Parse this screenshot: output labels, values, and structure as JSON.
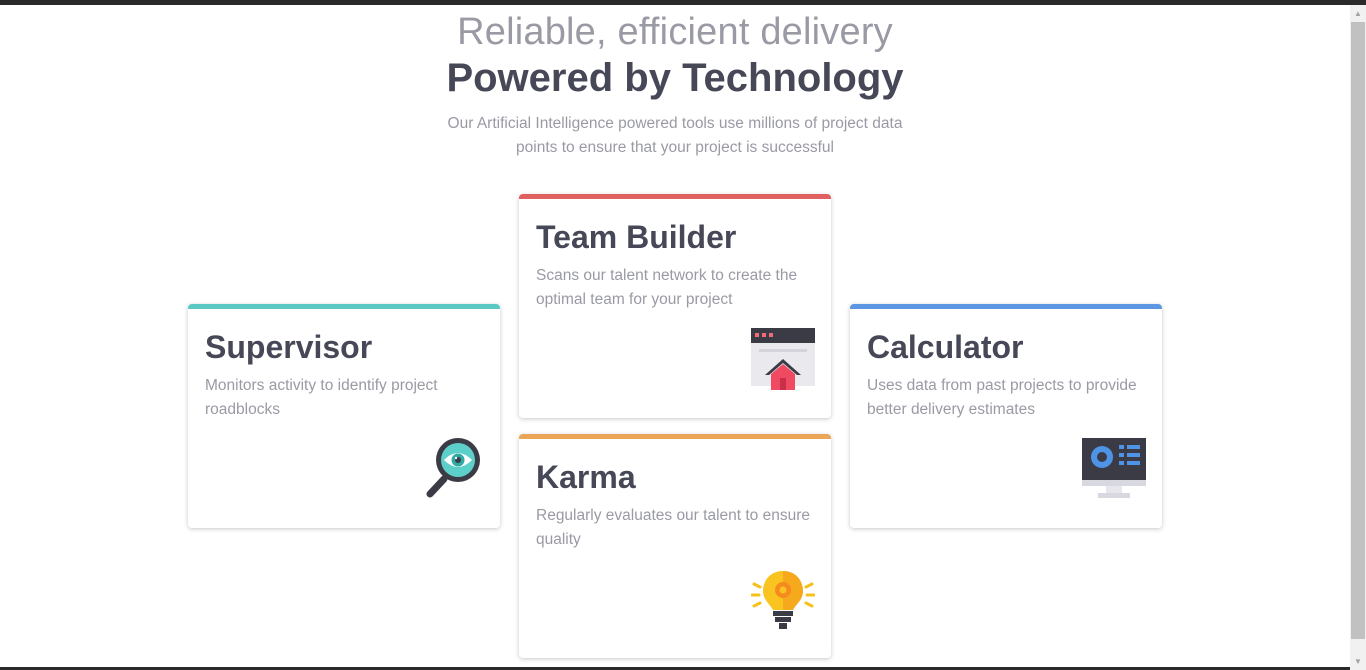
{
  "header": {
    "subheading": "Reliable, efficient delivery",
    "heading": "Powered by Technology",
    "description": "Our Artificial Intelligence powered tools use millions of project data points to ensure that your project is successful"
  },
  "cards": {
    "supervisor": {
      "title": "Supervisor",
      "description": "Monitors activity to identify project roadblocks",
      "icon": "magnifier-eye-icon",
      "accent": "#5bc8c4"
    },
    "team_builder": {
      "title": "Team Builder",
      "description": "Scans our talent network to create the optimal team for your project",
      "icon": "browser-house-icon",
      "accent": "#e0605f"
    },
    "karma": {
      "title": "Karma",
      "description": "Regularly evaluates our talent to ensure quality",
      "icon": "lightbulb-icon",
      "accent": "#eaa656"
    },
    "calculator": {
      "title": "Calculator",
      "description": "Uses data from past projects to provide better delivery estimates",
      "icon": "monitor-dashboard-icon",
      "accent": "#5d96e2"
    }
  }
}
